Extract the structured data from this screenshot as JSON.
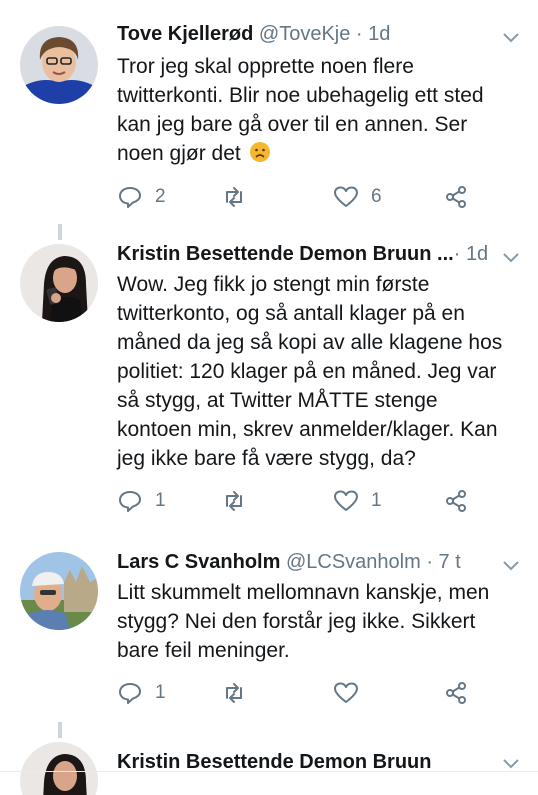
{
  "tweets": [
    {
      "name": "Tove Kjellerød",
      "handle": "@ToveKje",
      "sep": " · ",
      "time": "1d",
      "text": "Tror jeg skal opprette noen flere twitterkonti. Blir noe ubehagelig ett sted kan jeg bare gå over til en annen. Ser noen gjør det",
      "emoji": "disappointed-face-icon",
      "replies": "2",
      "retweets": "",
      "likes": "6"
    },
    {
      "name": "Kristin Besettende Demon Bruun ...",
      "handle": "",
      "sep": "· ",
      "time": "1d",
      "text": "Wow. Jeg fikk jo stengt min første twitterkonto, og så antall klager på en måned da jeg så kopi av alle klagene hos politiet: 120 klager på en måned. Jeg var så stygg, at Twitter MÅTTE stenge kontoen min, skrev anmelder/klager. Kan jeg ikke bare få være stygg, da?",
      "replies": "1",
      "retweets": "",
      "likes": "1"
    },
    {
      "name": "Lars C Svanholm",
      "handle": "@LCSvanholm",
      "sep": " · ",
      "time": "7 t",
      "text": "Litt skummelt mellomnavn kanskje, men stygg? Nei den forstår jeg ikke. Sikkert bare feil meninger.",
      "replies": "1",
      "retweets": "",
      "likes": ""
    },
    {
      "name": "Kristin Besettende Demon Bruun"
    }
  ],
  "colors": {
    "text": "#14171a",
    "muted": "#657786",
    "line": "#ccd6dd"
  }
}
